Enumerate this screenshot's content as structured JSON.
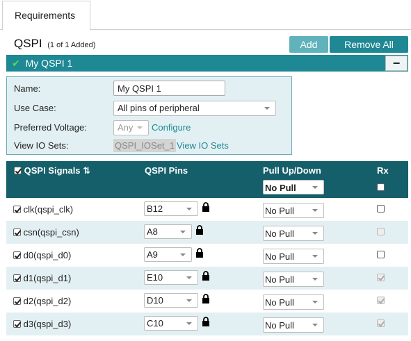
{
  "tabs": [
    {
      "label": "Requirements"
    }
  ],
  "header": {
    "title": "QSPI",
    "subtitle": "(1 of 1 Added)",
    "add_label": "Add",
    "remove_all_label": "Remove All"
  },
  "section": {
    "check_glyph": "✔",
    "title": "My QSPI 1",
    "collapse_glyph": "−"
  },
  "form": {
    "name_label": "Name:",
    "name_value": "My QSPI 1",
    "use_case_label": "Use Case:",
    "use_case_value": "All pins of peripheral",
    "voltage_label": "Preferred Voltage:",
    "voltage_value": "Any",
    "configure_link": "Configure",
    "io_sets_label": "View IO Sets:",
    "io_set_value": "QSPI_IOSet_1",
    "io_sets_link": "View IO Sets"
  },
  "table": {
    "col_signals": "QSPI Signals",
    "sort_glyph": "⇅",
    "col_pins": "QSPI Pins",
    "col_pull": "Pull Up/Down",
    "col_rx": "Rx",
    "header_pull_value": "No Pull",
    "rows": [
      {
        "signal": "clk(qspi_clk)",
        "pin": "B12",
        "pull": "No Pull",
        "rx_checked": false,
        "rx_enabled": true
      },
      {
        "signal": "csn(qspi_csn)",
        "pin": "A8",
        "pull": "No Pull",
        "rx_checked": false,
        "rx_enabled": false
      },
      {
        "signal": "d0(qspi_d0)",
        "pin": "A9",
        "pull": "No Pull",
        "rx_checked": false,
        "rx_enabled": true
      },
      {
        "signal": "d1(qspi_d1)",
        "pin": "E10",
        "pull": "No Pull",
        "rx_checked": true,
        "rx_enabled": false
      },
      {
        "signal": "d2(qspi_d2)",
        "pin": "D10",
        "pull": "No Pull",
        "rx_checked": true,
        "rx_enabled": false
      },
      {
        "signal": "d3(qspi_d3)",
        "pin": "C10",
        "pull": "No Pull",
        "rx_checked": true,
        "rx_enabled": false
      }
    ]
  },
  "colors": {
    "teal": "#1e8894",
    "teal_light": "#60b2bb",
    "table_header": "#145f6a",
    "row_alt": "#e3f0f3"
  }
}
